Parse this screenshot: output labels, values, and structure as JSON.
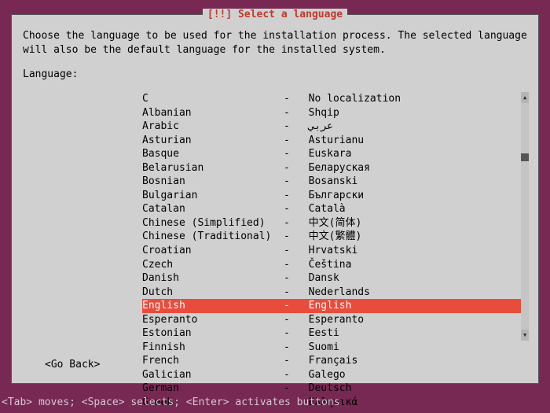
{
  "dialog": {
    "title": "[!!] Select a language",
    "instruction": "Choose the language to be used for the installation process. The selected language will\nalso be the default language for the installed system.",
    "field_label": "Language:",
    "go_back": "<Go Back>"
  },
  "languages": [
    {
      "name": "C",
      "native": "No localization",
      "selected": false
    },
    {
      "name": "Albanian",
      "native": "Shqip",
      "selected": false
    },
    {
      "name": "Arabic",
      "native": "عربي",
      "selected": false
    },
    {
      "name": "Asturian",
      "native": "Asturianu",
      "selected": false
    },
    {
      "name": "Basque",
      "native": "Euskara",
      "selected": false
    },
    {
      "name": "Belarusian",
      "native": "Беларуская",
      "selected": false
    },
    {
      "name": "Bosnian",
      "native": "Bosanski",
      "selected": false
    },
    {
      "name": "Bulgarian",
      "native": "Български",
      "selected": false
    },
    {
      "name": "Catalan",
      "native": "Català",
      "selected": false
    },
    {
      "name": "Chinese (Simplified)",
      "native": "中文(简体)",
      "selected": false
    },
    {
      "name": "Chinese (Traditional)",
      "native": "中文(繁體)",
      "selected": false
    },
    {
      "name": "Croatian",
      "native": "Hrvatski",
      "selected": false
    },
    {
      "name": "Czech",
      "native": "Čeština",
      "selected": false
    },
    {
      "name": "Danish",
      "native": "Dansk",
      "selected": false
    },
    {
      "name": "Dutch",
      "native": "Nederlands",
      "selected": false
    },
    {
      "name": "English",
      "native": "English",
      "selected": true
    },
    {
      "name": "Esperanto",
      "native": "Esperanto",
      "selected": false
    },
    {
      "name": "Estonian",
      "native": "Eesti",
      "selected": false
    },
    {
      "name": "Finnish",
      "native": "Suomi",
      "selected": false
    },
    {
      "name": "French",
      "native": "Français",
      "selected": false
    },
    {
      "name": "Galician",
      "native": "Galego",
      "selected": false
    },
    {
      "name": "German",
      "native": "Deutsch",
      "selected": false
    },
    {
      "name": "Greek",
      "native": "Ελληνικά",
      "selected": false
    }
  ],
  "footer": {
    "hint": "<Tab> moves; <Space> selects; <Enter> activates buttons"
  },
  "colors": {
    "background": "#772953",
    "dialog_bg": "#d0d0d0",
    "selection": "#e74c3c",
    "title_fg": "#c0392b"
  }
}
